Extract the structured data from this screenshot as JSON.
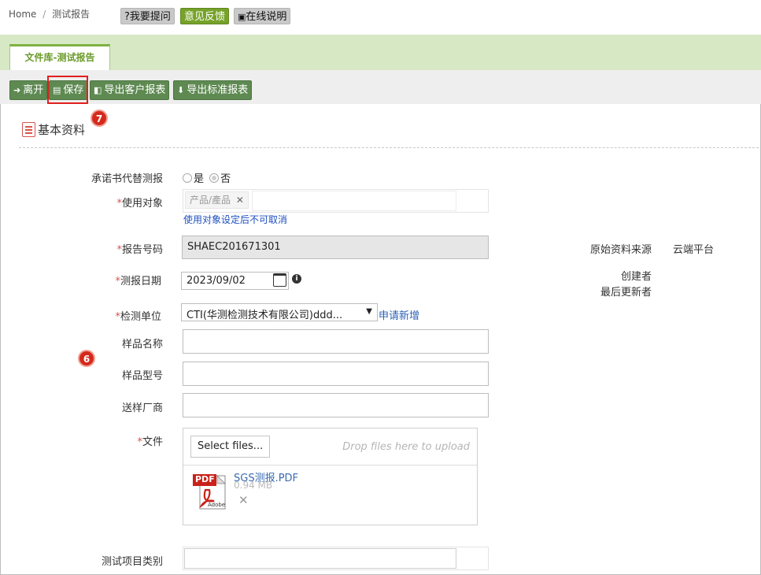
{
  "breadcrumb": {
    "home": "Home",
    "sep": "/",
    "current": "测试报告"
  },
  "top_buttons": {
    "ask": "?我要提问",
    "feedback": "意见反馈",
    "manual": "在线说明"
  },
  "tab": {
    "label": "文件库-测试报告"
  },
  "toolbar": {
    "leave": "离开",
    "save": "保存",
    "export_customer": "导出客户报表",
    "export_standard": "导出标准报表"
  },
  "badges": {
    "save_marker": "7",
    "form_marker": "6"
  },
  "section": {
    "title": "基本资料"
  },
  "form": {
    "commitment": {
      "label": "承诺书代替测报",
      "yes": "是",
      "no": "否"
    },
    "target": {
      "label": "使用对象",
      "tag": "产品/產品",
      "tag_remove": "✕",
      "note": "使用对象设定后不可取消"
    },
    "report_no": {
      "label": "报告号码",
      "value": "SHAEC201671301"
    },
    "test_date": {
      "label": "测报日期",
      "value": "2023/09/02"
    },
    "lab": {
      "label": "检测单位",
      "value": "CTI(华测检测技术有限公司)ddd...",
      "apply_link": "申请新增"
    },
    "sample_name": {
      "label": "样品名称",
      "value": ""
    },
    "sample_model": {
      "label": "样品型号",
      "value": ""
    },
    "sender": {
      "label": "送样厂商",
      "value": ""
    },
    "files": {
      "label": "文件",
      "select_button": "Select files...",
      "drop_hint": "Drop files here to upload",
      "file_name": "SGS测报.PDF",
      "file_size": "0.94 MB",
      "file_remove": "✕",
      "pdf_badge": "PDF",
      "pdf_brand": "Adobe"
    },
    "test_category": {
      "label": "测试项目类别",
      "value": ""
    }
  },
  "side_info": {
    "source_label": "原始资料来源",
    "source_value": "云端平台",
    "creator_label": "创建者",
    "updater_label": "最后更新者"
  }
}
